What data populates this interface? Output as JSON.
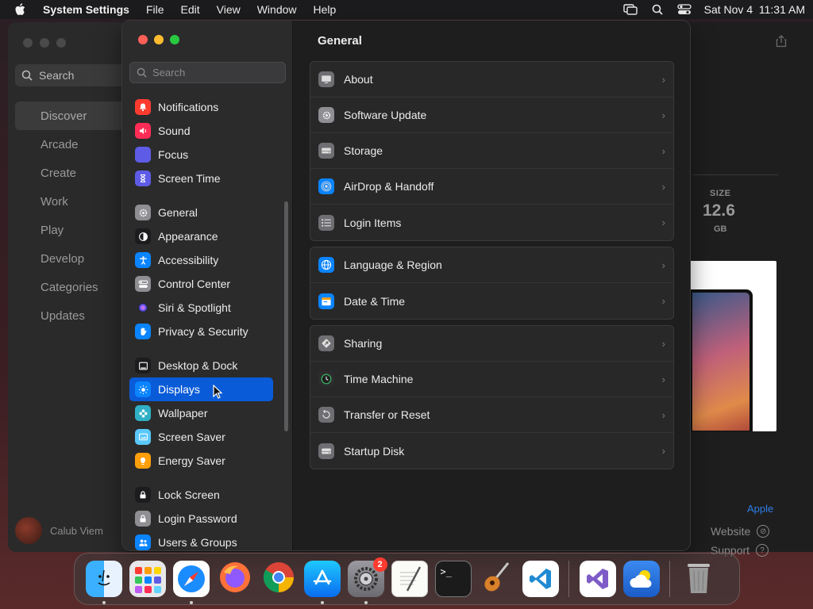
{
  "menubar": {
    "app_name": "System Settings",
    "menus": [
      "File",
      "Edit",
      "View",
      "Window",
      "Help"
    ],
    "datetime": "Sat Nov 4  11:31 AM"
  },
  "app_store": {
    "search_placeholder": "Search",
    "nav": [
      {
        "label": "Discover",
        "active": true
      },
      {
        "label": "Arcade"
      },
      {
        "label": "Create"
      },
      {
        "label": "Work"
      },
      {
        "label": "Play"
      },
      {
        "label": "Develop"
      },
      {
        "label": "Categories"
      },
      {
        "label": "Updates"
      }
    ],
    "user_name": "Calub Viem",
    "size_label": "SIZE",
    "size_value": "12.6",
    "size_unit": "GB",
    "developer_link": "Apple",
    "website_label": "Website",
    "support_label": "Support"
  },
  "settings": {
    "search_placeholder": "Search",
    "sidebar_groups": [
      [
        {
          "label": "Notifications",
          "icon": "bell-icon",
          "color": "#ff3b30"
        },
        {
          "label": "Sound",
          "icon": "speaker-icon",
          "color": "#ff2d55"
        },
        {
          "label": "Focus",
          "icon": "moon-icon",
          "color": "#5e5ce6"
        },
        {
          "label": "Screen Time",
          "icon": "hourglass-icon",
          "color": "#5e5ce6"
        }
      ],
      [
        {
          "label": "General",
          "icon": "gear-icon",
          "color": "#8e8e93"
        },
        {
          "label": "Appearance",
          "icon": "appearance-icon",
          "color": "#1c1c1e"
        },
        {
          "label": "Accessibility",
          "icon": "accessibility-icon",
          "color": "#0a84ff"
        },
        {
          "label": "Control Center",
          "icon": "control-center-icon",
          "color": "#8e8e93"
        },
        {
          "label": "Siri & Spotlight",
          "icon": "siri-icon",
          "color": "#bf5af2"
        },
        {
          "label": "Privacy & Security",
          "icon": "hand-icon",
          "color": "#0a84ff"
        }
      ],
      [
        {
          "label": "Desktop & Dock",
          "icon": "dock-icon",
          "color": "#1c1c1e"
        },
        {
          "label": "Displays",
          "icon": "sun-icon",
          "color": "#0a84ff",
          "selected": true
        },
        {
          "label": "Wallpaper",
          "icon": "flower-icon",
          "color": "#30b0c7"
        },
        {
          "label": "Screen Saver",
          "icon": "screensaver-icon",
          "color": "#5ac8fa"
        },
        {
          "label": "Energy Saver",
          "icon": "battery-icon",
          "color": "#ff9f0a"
        }
      ],
      [
        {
          "label": "Lock Screen",
          "icon": "lock-icon",
          "color": "#1c1c1e"
        },
        {
          "label": "Login Password",
          "icon": "lock-icon",
          "color": "#8e8e93"
        },
        {
          "label": "Users & Groups",
          "icon": "users-icon",
          "color": "#0a84ff"
        }
      ]
    ],
    "title": "General",
    "cards": [
      [
        {
          "label": "About",
          "icon": "display-icon"
        },
        {
          "label": "Software Update",
          "icon": "gear-icon"
        },
        {
          "label": "Storage",
          "icon": "drive-icon"
        },
        {
          "label": "AirDrop & Handoff",
          "icon": "airdrop-icon"
        },
        {
          "label": "Login Items",
          "icon": "list-icon"
        }
      ],
      [
        {
          "label": "Language & Region",
          "icon": "globe-icon"
        },
        {
          "label": "Date & Time",
          "icon": "calendar-icon"
        }
      ],
      [
        {
          "label": "Sharing",
          "icon": "sharing-icon"
        },
        {
          "label": "Time Machine",
          "icon": "time-machine-icon"
        },
        {
          "label": "Transfer or Reset",
          "icon": "reset-icon"
        },
        {
          "label": "Startup Disk",
          "icon": "drive-icon"
        }
      ]
    ]
  },
  "dock": {
    "apps": [
      {
        "name": "Finder",
        "icon": "finder-icon",
        "running": true
      },
      {
        "name": "Launchpad",
        "icon": "launchpad-icon"
      },
      {
        "name": "Safari",
        "icon": "safari-icon",
        "running": true
      },
      {
        "name": "Firefox",
        "icon": "firefox-icon"
      },
      {
        "name": "Chrome",
        "icon": "chrome-icon"
      },
      {
        "name": "App Store",
        "icon": "app-store-icon",
        "running": true
      },
      {
        "name": "System Settings",
        "icon": "settings-icon",
        "running": true,
        "badge": "2"
      },
      {
        "name": "TextEdit",
        "icon": "textedit-icon"
      },
      {
        "name": "Terminal",
        "icon": "terminal-icon"
      },
      {
        "name": "GarageBand",
        "icon": "guitar-icon"
      },
      {
        "name": "VS Code",
        "icon": "vscode-icon"
      },
      {
        "name": "Visual Studio",
        "icon": "visual-studio-icon"
      },
      {
        "name": "Weather",
        "icon": "weather-icon"
      },
      {
        "name": "Trash",
        "icon": "trash-icon"
      }
    ]
  }
}
